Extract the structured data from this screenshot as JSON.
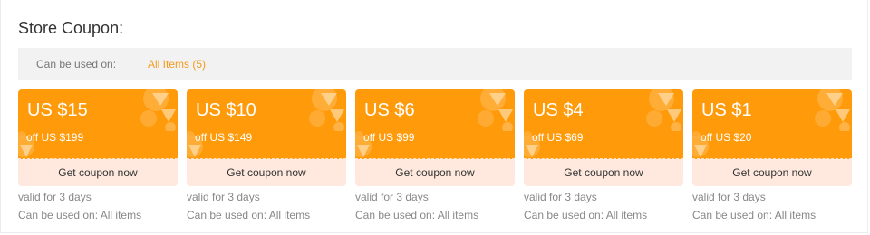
{
  "store_coupon": {
    "title": "Store Coupon:",
    "filter_label": "Can be used on:",
    "filter_value": "All Items (5)"
  },
  "colors": {
    "accent": "#ff9a0a",
    "button_bg": "#ffe9de",
    "filter_link": "#f49a1a"
  },
  "coupons": [
    {
      "amount": "US $15",
      "condition": "off US $199",
      "button": "Get coupon now",
      "validity": "valid for 3 days",
      "scope": "Can be used on: All items"
    },
    {
      "amount": "US $10",
      "condition": "off US $149",
      "button": "Get coupon now",
      "validity": "valid for 3 days",
      "scope": "Can be used on: All items"
    },
    {
      "amount": "US $6",
      "condition": "off US $99",
      "button": "Get coupon now",
      "validity": "valid for 3 days",
      "scope": "Can be used on: All items"
    },
    {
      "amount": "US $4",
      "condition": "off US $69",
      "button": "Get coupon now",
      "validity": "valid for 3 days",
      "scope": "Can be used on: All items"
    },
    {
      "amount": "US $1",
      "condition": "off US $20",
      "button": "Get coupon now",
      "validity": "valid for 3 days",
      "scope": "Can be used on: All items"
    }
  ]
}
